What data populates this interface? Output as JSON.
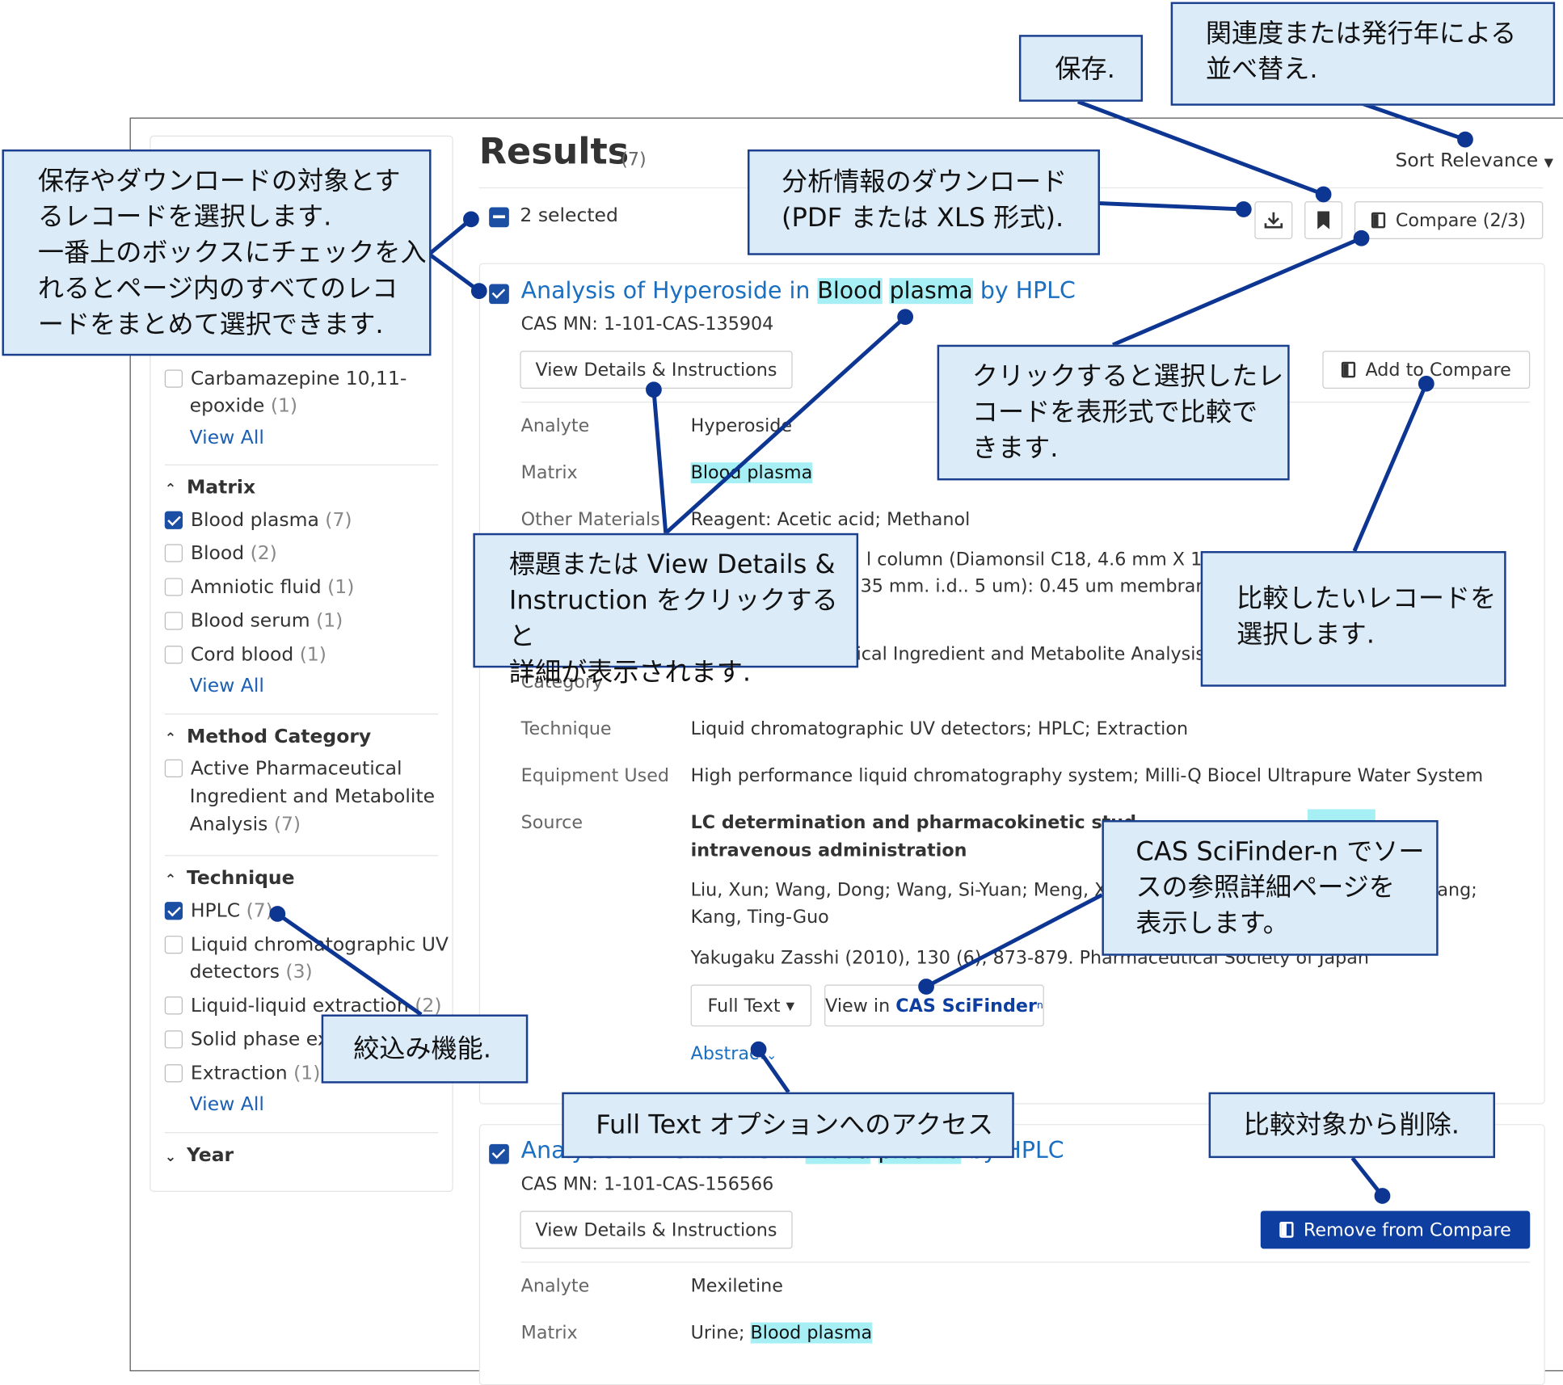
{
  "results": {
    "title": "Results",
    "count": "(7)",
    "selected": "2 selected",
    "sort_label": "Sort Relevance",
    "compare_label": "Compare (2/3)"
  },
  "filters": {
    "carbamazepine": {
      "label": "Carbamazepine 10,11-",
      "label2": "epoxide",
      "count": "(1)"
    },
    "view_all": "View All",
    "matrix": {
      "title": "Matrix",
      "items": [
        {
          "label": "Blood plasma",
          "count": "(7)",
          "checked": true
        },
        {
          "label": "Blood",
          "count": "(2)",
          "checked": false
        },
        {
          "label": "Amniotic fluid",
          "count": "(1)",
          "checked": false
        },
        {
          "label": "Blood serum",
          "count": "(1)",
          "checked": false
        },
        {
          "label": "Cord blood",
          "count": "(1)",
          "checked": false
        }
      ]
    },
    "method_category": {
      "title": "Method Category",
      "item1": "Active Pharmaceutical",
      "item2": "Ingredient and Metabolite",
      "item3": "Analysis",
      "count": "(7)"
    },
    "technique": {
      "title": "Technique",
      "items": [
        {
          "label": "HPLC",
          "count": "(7)",
          "checked": true
        },
        {
          "label": "Liquid chromatographic UV",
          "label2": "detectors",
          "count": "(3)",
          "checked": false
        },
        {
          "label": "Liquid-liquid extraction",
          "count": "(2)",
          "checked": false
        },
        {
          "label": "Solid phase ex",
          "count": "",
          "checked": false
        },
        {
          "label": "Extraction",
          "count": "(1)",
          "checked": false
        }
      ]
    },
    "year": {
      "title": "Year"
    }
  },
  "record1": {
    "title_a": "Analysis of Hyperoside in ",
    "title_hl1": "Blood",
    "title_hl2": "plasma",
    "title_b": " by HPLC",
    "cas": "CAS MN: 1-101-CAS-135904",
    "view_details": "View Details & Instructions",
    "add_compare": "Add to Compare",
    "analyte_label": "Analyte",
    "analyte": "Hyperoside",
    "matrix_label": "Matrix",
    "matrix": "Blood plasma",
    "other_label": "Other Materials",
    "other": "Reagent: Acetic acid; Methanol",
    "other2": "l column (Diamonsil C18, 4.6 mm X 150",
    "other3": "35 mm. i.d.. 5 um): 0.45 um membran",
    "method_cat_value": "ical Ingredient and Metabolite Analysis",
    "category_label": "Category",
    "technique_label": "Technique",
    "technique": "Liquid chromatographic UV detectors; HPLC; Extraction",
    "equipment_label": "Equipment Used",
    "equipment": "High performance liquid chromatography system; Milli-Q Biocel Ultrapure Water System",
    "source_label": "Source",
    "source_title1": "LC determination and pharmacokinetic stud",
    "source_title2": "intravenous administration",
    "authors1": "Liu, Xun; Wang, Dong; Wang, Si-Yuan; Meng, X",
    "authors1b": "ang;",
    "authors2": "Kang, Ting-Guo",
    "journal": "Yakugaku Zasshi (2010), 130 (6), 873-879. Pharmaceutical Society of Japan",
    "full_text": "Full Text",
    "view_in": "View in ",
    "scifinder": "CAS SciFinder",
    "abstract": "Abstract"
  },
  "record2": {
    "title_a": "Analysis of Mexiletine in ",
    "title_hl1": "Blood",
    "title_hl2": "plasma",
    "title_b": " by HPLC",
    "cas": "CAS MN: 1-101-CAS-156566",
    "view_details": "View Details & Instructions",
    "remove_compare": "Remove from Compare",
    "analyte_label": "Analyte",
    "analyte": "Mexiletine",
    "matrix_label": "Matrix",
    "matrix_a": "Urine; ",
    "matrix_hl": "Blood plasma"
  },
  "callouts": {
    "select": [
      "保存やダウンロードの対象とす",
      "るレコードを選択します.",
      "一番上のボックスにチェックを入",
      "れるとページ内のすべてのレコ",
      "ードをまとめて選択できます."
    ],
    "save": "保存.",
    "sort": [
      "関連度または発行年による",
      "並べ替え."
    ],
    "download": [
      "分析情報のダウンロード",
      "(PDF または XLS 形式)."
    ],
    "compare": [
      "クリックすると選択したレ",
      "コードを表形式で比較で",
      "きます."
    ],
    "details": [
      "標題または View Details &",
      "Instruction をクリックすると",
      "詳細が表示されます."
    ],
    "add_compare": [
      "比較したいレコードを",
      "選択します."
    ],
    "scifinder": [
      "CAS SciFinder-n でソー",
      "スの参照詳細ページを",
      "表示します。"
    ],
    "filter": "絞込み機能.",
    "fulltext": "Full Text オプションへのアクセス",
    "remove": "比較対象から削除."
  },
  "colors": {
    "accent": "#1a4fa3",
    "link": "#1a6fc0",
    "highlight": "#a6f0f5",
    "callout_bg": "#dcebf8",
    "callout_border": "#1a3f8f"
  }
}
